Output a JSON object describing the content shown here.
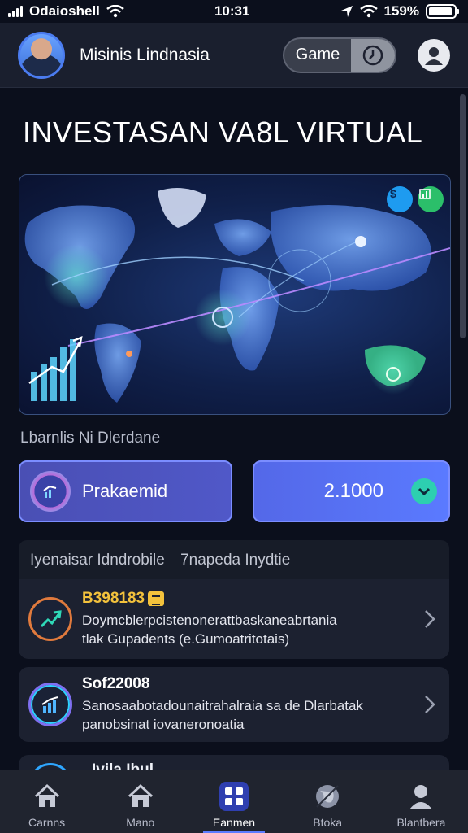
{
  "status_bar": {
    "carrier": "Odaioshell",
    "time": "10:31",
    "battery": "159%",
    "battery_level": 0.95
  },
  "header": {
    "user_name": "Misinis Lindnasia",
    "toggle_label": "Game",
    "avatar_icon": "user-avatar",
    "profile_icon": "person-icon"
  },
  "page": {
    "title": "INVESTASAN VA8L VIRTUAL",
    "section_label": "Lbarnlis Ni Dlerdane"
  },
  "map": {
    "badges": [
      {
        "icon": "dollar-icon",
        "color": "#1e9bf0"
      },
      {
        "icon": "chart-icon",
        "color": "#2bbf6a"
      }
    ]
  },
  "actions": {
    "left_label": "Prakaemid",
    "right_value": "2.1000"
  },
  "list": {
    "header_left": "Iyenaisar Idndrobile",
    "header_right": "7napeda Inydtie",
    "items": [
      {
        "title": "B398183",
        "desc_line1": "Doymcblerpcistenonerattbaskaneabrtania",
        "desc_line2": "tlak Gupadents (e.Gumoatritotais)",
        "icon": "trend-up-icon"
      },
      {
        "title": "Sof22008",
        "desc_line1": "Sanosaabotadounaitrahalraia sa de Dlarbatak",
        "desc_line2": "panobsinat iovaneronoatia",
        "icon": "bar-chart-icon"
      },
      {
        "title": "Ivila Ibul",
        "icon": "circle-icon"
      }
    ]
  },
  "bottom_nav": {
    "items": [
      {
        "label": "Carnns",
        "icon": "home-icon"
      },
      {
        "label": "Mano",
        "icon": "home-icon"
      },
      {
        "label": "Eanmen",
        "icon": "grid-icon",
        "active": true
      },
      {
        "label": "Btoka",
        "icon": "globe-icon"
      },
      {
        "label": "Blantbera",
        "icon": "person-icon"
      }
    ]
  },
  "colors": {
    "background": "#0b0f1c",
    "accent": "#5b7cff",
    "highlight": "#f3c23c",
    "teal": "#2dcfb0"
  }
}
